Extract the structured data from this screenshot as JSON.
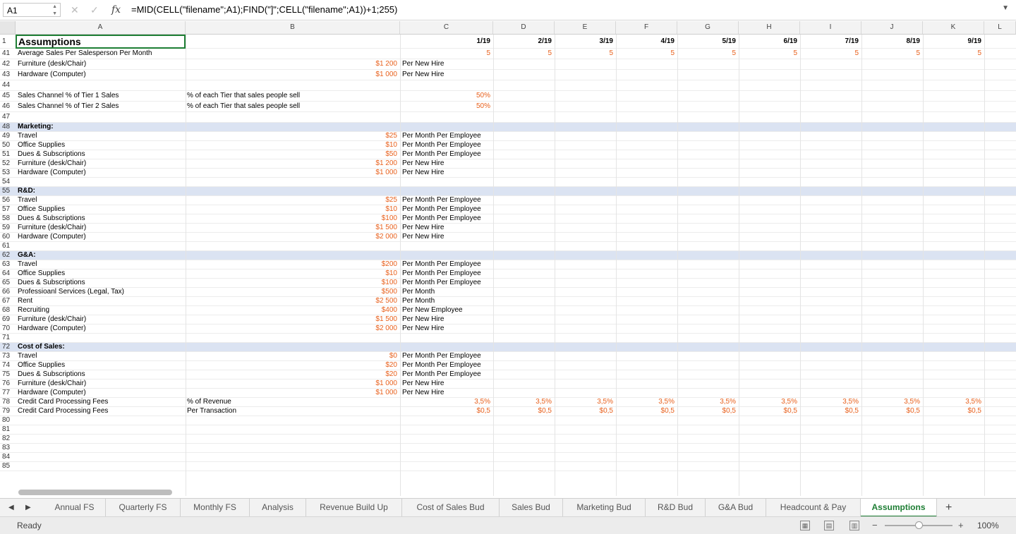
{
  "formula_bar": {
    "name_box": "A1",
    "fx_label": "fx",
    "formula": "=MID(CELL(\"filename\";A1);FIND(\"]\";CELL(\"filename\";A1))+1;255)"
  },
  "columns": [
    "A",
    "B",
    "C",
    "D",
    "E",
    "F",
    "G",
    "H",
    "I",
    "J",
    "K",
    "L"
  ],
  "month_headers": [
    "1/19",
    "2/19",
    "3/19",
    "4/19",
    "5/19",
    "6/19",
    "7/19",
    "8/19",
    "9/19"
  ],
  "rows": [
    {
      "n": "1",
      "a": "Assumptions",
      "title": true,
      "months": [
        "1/19",
        "2/19",
        "3/19",
        "4/19",
        "5/19",
        "6/19",
        "7/19",
        "8/19",
        "9/19"
      ]
    },
    {
      "n": "41",
      "a": "Average Sales Per Salesperson Per Month",
      "months": [
        "5",
        "5",
        "5",
        "5",
        "5",
        "5",
        "5",
        "5",
        "5"
      ]
    },
    {
      "n": "42",
      "a": "Furniture (desk/Chair)",
      "c": "$1 200",
      "unit": "Per New Hire"
    },
    {
      "n": "43",
      "a": "Hardware (Computer)",
      "c": "$1 000",
      "unit": "Per New Hire"
    },
    {
      "n": "44"
    },
    {
      "n": "45",
      "a": "Sales Channel % of Tier 1 Sales",
      "b": "% of each Tier that sales people sell",
      "c": "50%"
    },
    {
      "n": "46",
      "a": "Sales Channel % of Tier 2 Sales",
      "b": "% of each Tier that sales people sell",
      "c": "50%"
    },
    {
      "n": "47"
    },
    {
      "n": "48",
      "a": "Marketing:",
      "section": true
    },
    {
      "n": "49",
      "a": "Travel",
      "c": "$25",
      "unit": "Per Month Per Employee"
    },
    {
      "n": "50",
      "a": "Office Supplies",
      "c": "$10",
      "unit": "Per Month Per Employee"
    },
    {
      "n": "51",
      "a": "Dues & Subscriptions",
      "c": "$50",
      "unit": "Per Month Per Employee"
    },
    {
      "n": "52",
      "a": "Furniture (desk/Chair)",
      "c": "$1 200",
      "unit": "Per New Hire"
    },
    {
      "n": "53",
      "a": "Hardware (Computer)",
      "c": "$1 000",
      "unit": "Per New Hire"
    },
    {
      "n": "54"
    },
    {
      "n": "55",
      "a": "R&D:",
      "section": true
    },
    {
      "n": "56",
      "a": "Travel",
      "c": "$25",
      "unit": "Per Month Per Employee"
    },
    {
      "n": "57",
      "a": "Office Supplies",
      "c": "$10",
      "unit": "Per Month Per Employee"
    },
    {
      "n": "58",
      "a": "Dues & Subscriptions",
      "c": "$100",
      "unit": "Per Month Per Employee"
    },
    {
      "n": "59",
      "a": "Furniture (desk/Chair)",
      "c": "$1 500",
      "unit": "Per New Hire"
    },
    {
      "n": "60",
      "a": "Hardware (Computer)",
      "c": "$2 000",
      "unit": "Per New Hire"
    },
    {
      "n": "61"
    },
    {
      "n": "62",
      "a": "G&A:",
      "section": true
    },
    {
      "n": "63",
      "a": "Travel",
      "c": "$200",
      "unit": "Per Month Per Employee"
    },
    {
      "n": "64",
      "a": "Office Supplies",
      "c": "$10",
      "unit": "Per Month Per Employee"
    },
    {
      "n": "65",
      "a": "Dues & Subscriptions",
      "c": "$100",
      "unit": "Per Month Per Employee"
    },
    {
      "n": "66",
      "a": "Professioanl Services (Legal, Tax)",
      "c": "$500",
      "unit": "Per Month"
    },
    {
      "n": "67",
      "a": "Rent",
      "c": "$2 500",
      "unit": "Per Month"
    },
    {
      "n": "68",
      "a": "Recruiting",
      "c": "$400",
      "unit": "Per New Employee"
    },
    {
      "n": "69",
      "a": "Furniture (desk/Chair)",
      "c": "$1 500",
      "unit": "Per New Hire"
    },
    {
      "n": "70",
      "a": "Hardware (Computer)",
      "c": "$2 000",
      "unit": "Per New Hire"
    },
    {
      "n": "71"
    },
    {
      "n": "72",
      "a": "Cost of Sales:",
      "section": true
    },
    {
      "n": "73",
      "a": "Travel",
      "c": "$0",
      "unit": "Per Month Per Employee"
    },
    {
      "n": "74",
      "a": "Office Supplies",
      "c": "$20",
      "unit": "Per Month Per Employee"
    },
    {
      "n": "75",
      "a": "Dues & Subscriptions",
      "c": "$20",
      "unit": "Per Month Per Employee"
    },
    {
      "n": "76",
      "a": "Furniture (desk/Chair)",
      "c": "$1 000",
      "unit": "Per New Hire"
    },
    {
      "n": "77",
      "a": "Hardware (Computer)",
      "c": "$1 000",
      "unit": "Per New Hire"
    },
    {
      "n": "78",
      "a": "Credit Card Processing Fees",
      "b": "% of Revenue",
      "months": [
        "3,5%",
        "3,5%",
        "3,5%",
        "3,5%",
        "3,5%",
        "3,5%",
        "3,5%",
        "3,5%",
        "3,5%"
      ]
    },
    {
      "n": "79",
      "a": "Credit Card Processing Fees",
      "b": "Per Transaction",
      "months": [
        "$0,5",
        "$0,5",
        "$0,5",
        "$0,5",
        "$0,5",
        "$0,5",
        "$0,5",
        "$0,5",
        "$0,5"
      ]
    },
    {
      "n": "80"
    },
    {
      "n": "81"
    },
    {
      "n": "82"
    },
    {
      "n": "83"
    },
    {
      "n": "84"
    },
    {
      "n": "85"
    }
  ],
  "sheet_tabs": [
    {
      "label": "Annual FS"
    },
    {
      "label": "Quarterly FS"
    },
    {
      "label": "Monthly FS"
    },
    {
      "label": "Analysis"
    },
    {
      "label": "Revenue Build Up"
    },
    {
      "label": "Cost of Sales Bud"
    },
    {
      "label": "Sales Bud"
    },
    {
      "label": "Marketing Bud"
    },
    {
      "label": "R&D Bud"
    },
    {
      "label": "G&A Bud"
    },
    {
      "label": "Headcount & Pay"
    },
    {
      "label": "Assumptions",
      "active": true
    }
  ],
  "add_sheet_label": "+",
  "status": {
    "text": "Ready",
    "zoom": "100%",
    "zoom_minus": "−",
    "zoom_plus": "+",
    "zoom_fraction": 0.5
  },
  "colors": {
    "accent_orange": "#e8601c",
    "active_tab_green": "#1e7e34",
    "section_band": "#dbe3f2"
  }
}
